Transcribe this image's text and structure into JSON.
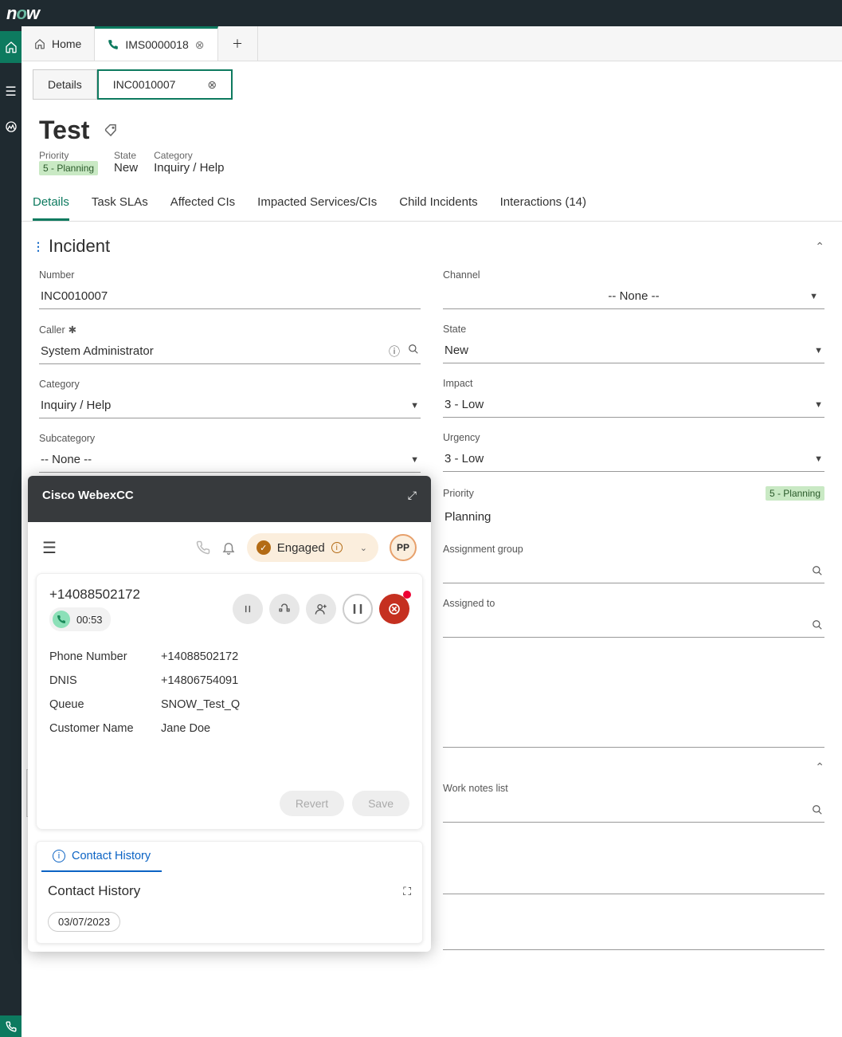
{
  "logo": "now",
  "tabs": [
    {
      "label": "Home",
      "icon": "home"
    },
    {
      "label": "IMS0000018",
      "icon": "phone",
      "closable": true
    }
  ],
  "subtabs": [
    {
      "label": "Details"
    },
    {
      "label": "INC0010007",
      "closable": true,
      "active": true
    }
  ],
  "record": {
    "title": "Test",
    "meta": {
      "priority": {
        "label": "Priority",
        "value": "5 - Planning"
      },
      "state": {
        "label": "State",
        "value": "New"
      },
      "category": {
        "label": "Category",
        "value": "Inquiry / Help"
      }
    }
  },
  "detailTabs": [
    "Details",
    "Task SLAs",
    "Affected CIs",
    "Impacted Services/CIs",
    "Child Incidents",
    "Interactions (14)"
  ],
  "section": {
    "title": "Incident"
  },
  "form": {
    "number": {
      "label": "Number",
      "value": "INC0010007"
    },
    "caller": {
      "label": "Caller",
      "value": "System Administrator"
    },
    "category": {
      "label": "Category",
      "value": "Inquiry / Help"
    },
    "subcategory": {
      "label": "Subcategory",
      "value": "-- None --"
    },
    "channel": {
      "label": "Channel",
      "value": "-- None --"
    },
    "state": {
      "label": "State",
      "value": "New"
    },
    "impact": {
      "label": "Impact",
      "value": "3 - Low"
    },
    "urgency": {
      "label": "Urgency",
      "value": "3 - Low"
    },
    "priority": {
      "label": "Priority",
      "value": "Planning",
      "badge": "5 - Planning"
    },
    "assignment_group": {
      "label": "Assignment group",
      "value": ""
    },
    "assigned_to": {
      "label": "Assigned to",
      "value": ""
    },
    "work_notes_list": {
      "label": "Work notes list",
      "value": ""
    }
  },
  "cisco": {
    "title": "Cisco WebexCC",
    "status": "Engaged",
    "avatar": "PP",
    "call": {
      "phone": "+14088502172",
      "duration": "00:53",
      "details": {
        "phone_number": {
          "label": "Phone Number",
          "value": "+14088502172"
        },
        "dnis": {
          "label": "DNIS",
          "value": "+14806754091"
        },
        "queue": {
          "label": "Queue",
          "value": "SNOW_Test_Q"
        },
        "customer_name": {
          "label": "Customer Name",
          "value": "Jane Doe"
        }
      }
    },
    "buttons": {
      "revert": "Revert",
      "save": "Save"
    },
    "history": {
      "tab": "Contact History",
      "heading": "Contact History",
      "date": "03/07/2023"
    }
  }
}
